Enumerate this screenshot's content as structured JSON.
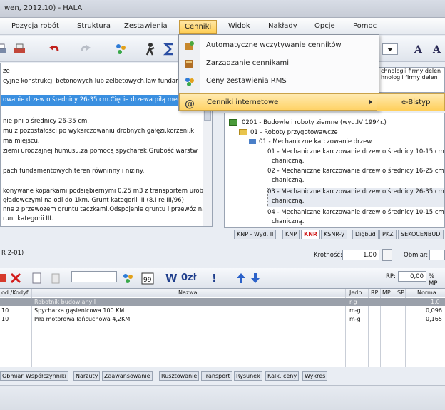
{
  "window": {
    "title": "wen, 2012.10) - HALA"
  },
  "menu": {
    "items": [
      "Pozycja robót",
      "Struktura",
      "Zestawienia",
      "Cenniki",
      "Widok",
      "Nakłady",
      "Opcje",
      "Pomoc"
    ],
    "active": "Cenniki"
  },
  "dropdown": {
    "items": [
      {
        "label": "Automatyczne wczytywanie cenników",
        "icon": "auto-load-icon"
      },
      {
        "label": "Zarządzanie cennikami",
        "icon": "manage-prices-icon"
      },
      {
        "label": "Ceny zestawienia RMS",
        "icon": "rms-prices-icon"
      },
      {
        "label": "Cenniki internetowe",
        "icon": "internet-at-icon"
      }
    ],
    "submenu": "e-Bistyp"
  },
  "left_text": {
    "lines": [
      "ze",
      "cyjne konstrukcji betonowych lub żelbetowych,law fundamen",
      "owanie drzew o średnicy 26-35 cm.Cięcie drzewa piłą mecha",
      "",
      "nie pni o średnicy 26-35 cm.",
      "mu z pozostałości po wykarczowaniu drobnych gałęzi,korzeni,k",
      "ma miejscu.",
      "ziemi urodzajnej humusu,za pomocą spycharek.Grubość warstw",
      "",
      "pach fundamentowych,teren równinny i niziny.",
      "",
      "konywane koparkami podsiębiernymi 0,25 m3 z transportem urobku",
      "gładowczymi na odl do 1km. Grunt kategorii III (8.I re III/96)",
      "nne z przewozem gruntu taczkami.Odspojenie gruntu i przewóz na",
      "runt kategorii III."
    ]
  },
  "right_text": [
    "chnologii firmy delen",
    "hnologii firmy delen",
    "",
    "chnologii firmy delen"
  ],
  "tree": {
    "nodes": [
      "0201 - Budowle i roboty ziemne (wyd.IV 1994r.)",
      "01 - Roboty przygotowawcze",
      "01 - Mechaniczne karczowanie drzew",
      "01 - Mechaniczne karczowanie drzew o średnicy 10-15 cm",
      "chaniczną.",
      "02 - Mechaniczne karczowanie drzew o średnicy 16-25 cm",
      "chaniczną.",
      "03 - Mechaniczne karczowanie drzew o średnicy 26-35 cm",
      "chaniczną.",
      "04 - Mechaniczne karczowanie drzew o średnicy 10-15 cm",
      "chaniczną."
    ]
  },
  "catalog_tabs": [
    "KNP - Wyd. II",
    "KNP",
    "KNR",
    "KSNR-y",
    "Digbud",
    "PKZ",
    "SEKOCENBUD"
  ],
  "position_ref": "R 2-01)",
  "fields": {
    "krotnosc_label": "Krotność:",
    "krotnosc_value": "1,00",
    "obmiar_label": "Obmiar:",
    "rp_label": "RP:",
    "rp_value": "0,00",
    "percent_mp": "% MP"
  },
  "toolbar2": {
    "w_label": "W",
    "ozi_label": "0zł",
    "exclaim": "!"
  },
  "grid": {
    "headers": [
      "od./Kodyf.",
      "Nazwa",
      "Jedn.",
      "RP",
      "MP",
      "SP",
      "Norma"
    ],
    "rows": [
      {
        "code": "",
        "name": "Robotnik budowlany I",
        "unit": "r-g",
        "norm": "1,0"
      },
      {
        "code": "10",
        "name": "Spycharka gąsienicowa 100 KM",
        "unit": "m-g",
        "norm": "0,096"
      },
      {
        "code": "10",
        "name": "Piła motorowa łańcuchowa 4,2KM",
        "unit": "m-g",
        "norm": "0,165"
      }
    ]
  },
  "bottom_tabs": [
    "Obmiar",
    "Współczynniki",
    "Narzuty",
    "Zaawansowanie",
    "Rusztowanie",
    "Transport",
    "Rysunek",
    "Kalk. ceny",
    "Wykres"
  ]
}
